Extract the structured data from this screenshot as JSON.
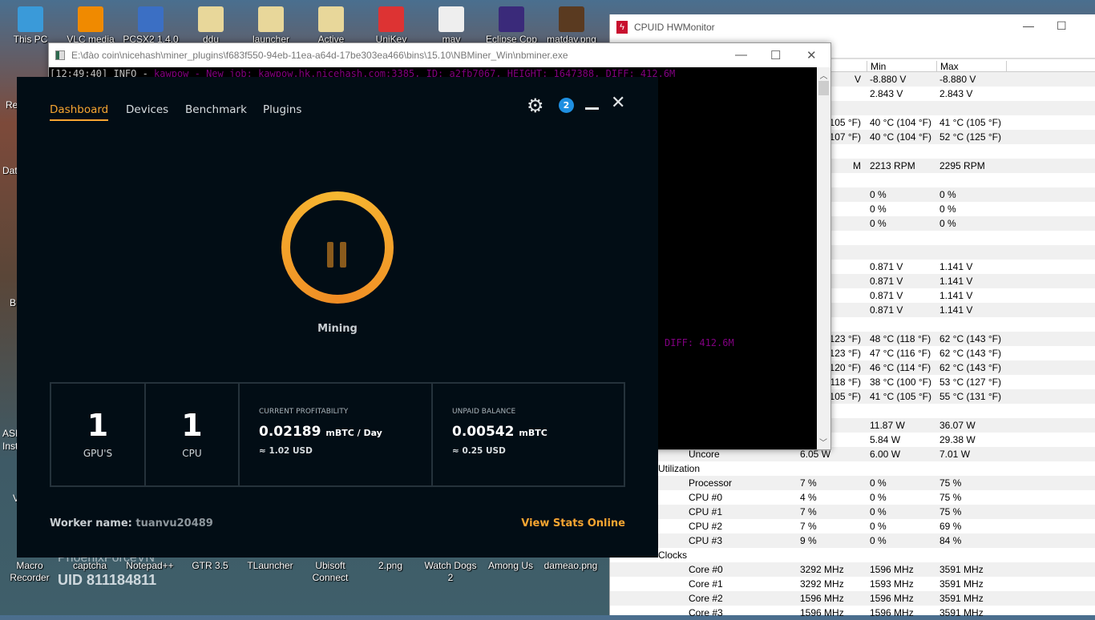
{
  "desktop": {
    "top_icons": [
      "This PC",
      "VLC media",
      "PCSX2 1.4.0",
      "ddu",
      "launcher",
      "Active",
      "UniKey",
      "may",
      "Eclipse Cpp",
      "matday.png"
    ],
    "left_partial_labels": [
      "Re",
      "Dat",
      "B",
      "ASI",
      "Inst",
      "V"
    ],
    "bottom_icons": [
      [
        "Macro",
        "Recorder"
      ],
      [
        "captcha",
        ""
      ],
      [
        "Notepad++",
        ""
      ],
      [
        "GTR 3.5",
        ""
      ],
      [
        "TLauncher",
        ""
      ],
      [
        "Ubisoft",
        "Connect"
      ],
      [
        "2.png",
        ""
      ],
      [
        "Watch Dogs",
        "2"
      ],
      [
        "Among Us",
        ""
      ],
      [
        "dameao.png",
        ""
      ]
    ],
    "game_overlay": {
      "uid": "UID 811184811",
      "name": "PhoenixForceVN"
    }
  },
  "hwmonitor": {
    "title": "CPUID HWMonitor",
    "columns": {
      "min": "Min",
      "max": "Max"
    },
    "rows": [
      {
        "v": "V",
        "min": "-8.880 V",
        "max": "-8.880 V",
        "p": 1
      },
      {
        "min": "2.843 V",
        "max": "2.843 V"
      },
      {},
      {
        "v": "105 °F)",
        "min": "40 °C  (104 °F)",
        "max": "41 °C  (105 °F)",
        "p": 1
      },
      {
        "v": "107 °F)",
        "min": "40 °C  (104 °F)",
        "max": "52 °C  (125 °F)",
        "p": 1
      },
      {},
      {
        "v": "M",
        "min": "2213 RPM",
        "max": "2295 RPM",
        "p": 1
      },
      {},
      {
        "min": "0 %",
        "max": "0 %"
      },
      {
        "min": "0 %",
        "max": "0 %"
      },
      {
        "min": "0 %",
        "max": "0 %"
      },
      {},
      {},
      {
        "min": "0.871 V",
        "max": "1.141 V"
      },
      {
        "min": "0.871 V",
        "max": "1.141 V"
      },
      {
        "min": "0.871 V",
        "max": "1.141 V"
      },
      {
        "min": "0.871 V",
        "max": "1.141 V"
      },
      {},
      {
        "v": "123 °F)",
        "min": "48 °C  (118 °F)",
        "max": "62 °C  (143 °F)",
        "p": 1
      },
      {
        "v": "123 °F)",
        "min": "47 °C  (116 °F)",
        "max": "62 °C  (143 °F)",
        "p": 1
      },
      {
        "v": "120 °F)",
        "min": "46 °C  (114 °F)",
        "max": "62 °C  (143 °F)",
        "p": 1
      },
      {
        "v": "118 °F)",
        "min": "38 °C  (100 °F)",
        "max": "53 °C  (127 °F)",
        "p": 1
      },
      {
        "v": "105 °F)",
        "min": "41 °C  (105 °F)",
        "max": "55 °C  (131 °F)",
        "p": 1
      },
      {},
      {
        "min": "11.87 W",
        "max": "36.07 W"
      },
      {
        "min": "5.84 W",
        "max": "29.38 W"
      },
      {
        "n": "Uncore",
        "v": "6.05 W",
        "min": "6.00 W",
        "max": "7.01 W"
      },
      {
        "g": "Utilization"
      },
      {
        "n": "Processor",
        "v": "7 %",
        "min": "0 %",
        "max": "75 %"
      },
      {
        "n": "CPU #0",
        "v": "4 %",
        "min": "0 %",
        "max": "75 %"
      },
      {
        "n": "CPU #1",
        "v": "7 %",
        "min": "0 %",
        "max": "75 %"
      },
      {
        "n": "CPU #2",
        "v": "7 %",
        "min": "0 %",
        "max": "69 %"
      },
      {
        "n": "CPU #3",
        "v": "9 %",
        "min": "0 %",
        "max": "84 %"
      },
      {
        "g": "Clocks"
      },
      {
        "n": "Core #0",
        "v": "3292 MHz",
        "min": "1596 MHz",
        "max": "3591 MHz"
      },
      {
        "n": "Core #1",
        "v": "3292 MHz",
        "min": "1593 MHz",
        "max": "3591 MHz"
      },
      {
        "n": "Core #2",
        "v": "1596 MHz",
        "min": "1596 MHz",
        "max": "3591 MHz"
      },
      {
        "n": "Core #3",
        "v": "1596 MHz",
        "min": "1596 MHz",
        "max": "3591 MHz"
      }
    ]
  },
  "console": {
    "title": "E:\\đào coin\\nicehash\\miner_plugins\\f683f550-94eb-11ea-a64d-17be303ea466\\bins\\15.10\\NBMiner_Win\\nbminer.exe",
    "line1_prefix": "[12:49:40] INFO - ",
    "line1_msg": "kawpow - New job: kawpow.hk.nicehash.com:3385, ID: a2fb7067, HEIGHT: 1647388, DIFF: 412.6M",
    "line2_visible": "DIFF: 412.6M"
  },
  "nicehash": {
    "tabs": [
      "Dashboard",
      "Devices",
      "Benchmark",
      "Plugins"
    ],
    "notification_count": "2",
    "status": "Mining",
    "gpus": {
      "value": "1",
      "label": "GPU'S"
    },
    "cpus": {
      "value": "1",
      "label": "CPU"
    },
    "profitability": {
      "label": "CURRENT PROFITABILITY",
      "value": "0.02189",
      "unit": "mBTC / Day",
      "usd": "≈ 1.02 USD"
    },
    "balance": {
      "label": "UNPAID BALANCE",
      "value": "0.00542",
      "unit": "mBTC",
      "usd": "≈ 0.25 USD"
    },
    "worker_label": "Worker name:",
    "worker_name": "tuanvu20489",
    "view_stats": "View Stats Online",
    "accent": "#f7a531"
  }
}
